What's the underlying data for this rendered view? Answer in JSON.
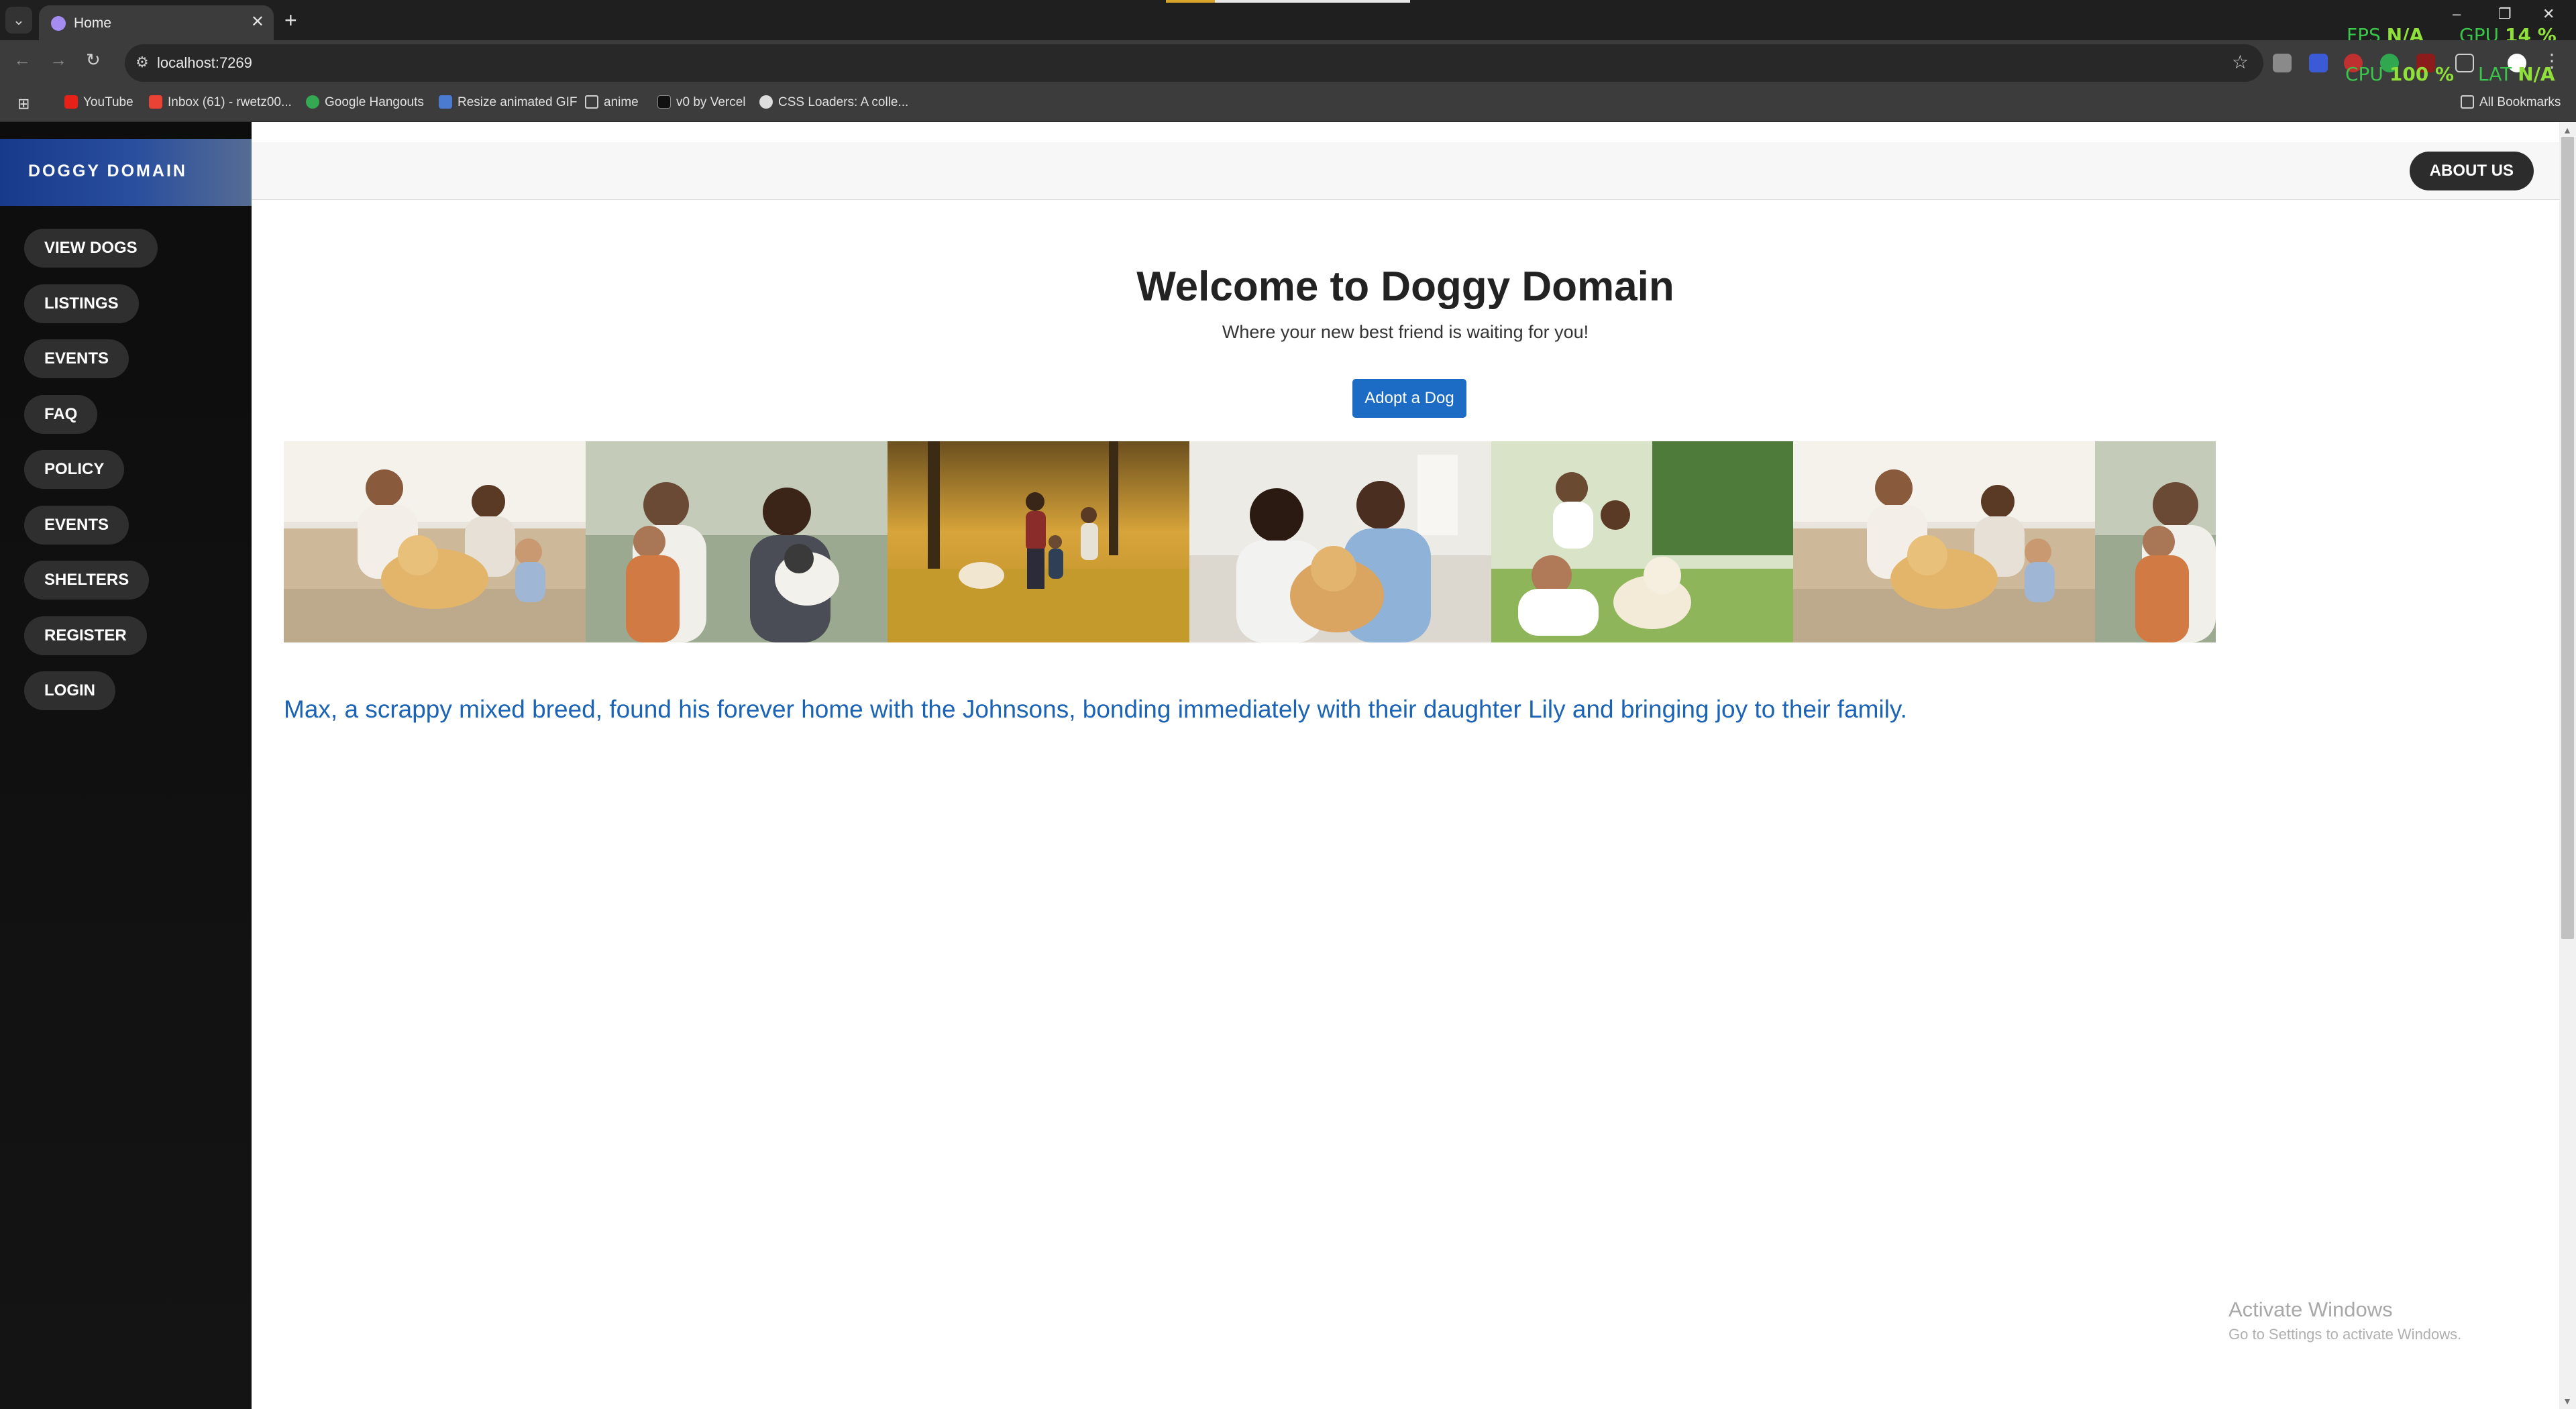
{
  "browser": {
    "tab_title": "Home",
    "url": "localhost:7269",
    "bookmarks": [
      "YouTube",
      "Inbox (61) - rwetz00...",
      "Google Hangouts",
      "Resize animated GIF",
      "anime",
      "v0 by Vercel",
      "CSS Loaders: A colle..."
    ],
    "all_bookmarks": "All Bookmarks",
    "overlay": {
      "fps_label": "FPS",
      "fps_value": "N/A",
      "gpu_label": "GPU",
      "gpu_value": "14 %",
      "cpu_label": "CPU",
      "cpu_value": "100 %",
      "lat_label": "LAT",
      "lat_value": "N/A"
    }
  },
  "sidebar": {
    "brand": "DOGGY DOMAIN",
    "items": [
      "VIEW DOGS",
      "LISTINGS",
      "EVENTS",
      "FAQ",
      "POLICY",
      "EVENTS",
      "SHELTERS",
      "REGISTER",
      "LOGIN"
    ]
  },
  "topbar": {
    "about": "ABOUT US"
  },
  "hero": {
    "title": "Welcome to Doggy Domain",
    "subtitle": "Where your new best friend is waiting for you!",
    "cta": "Adopt a Dog"
  },
  "gallery": {
    "photos": [
      "family-on-couch-with-golden-retriever",
      "mother-daughter-father-with-dog",
      "family-running-in-autumn-park",
      "couple-with-golden-retriever",
      "family-on-grass-with-dog",
      "family-on-couch-with-golden-retriever",
      "mother-daughter-father-with-dog"
    ]
  },
  "story": "Max, a scrappy mixed breed, found his forever home with the Johnsons, bonding immediately with their daughter Lily and bringing joy to their family.",
  "windows": {
    "activate_title": "Activate Windows",
    "activate_sub": "Go to Settings to activate Windows."
  },
  "colors": {
    "brand_blue": "#1c6cc5",
    "story_blue": "#1a63b5",
    "sidebar_bg": "#111111"
  }
}
